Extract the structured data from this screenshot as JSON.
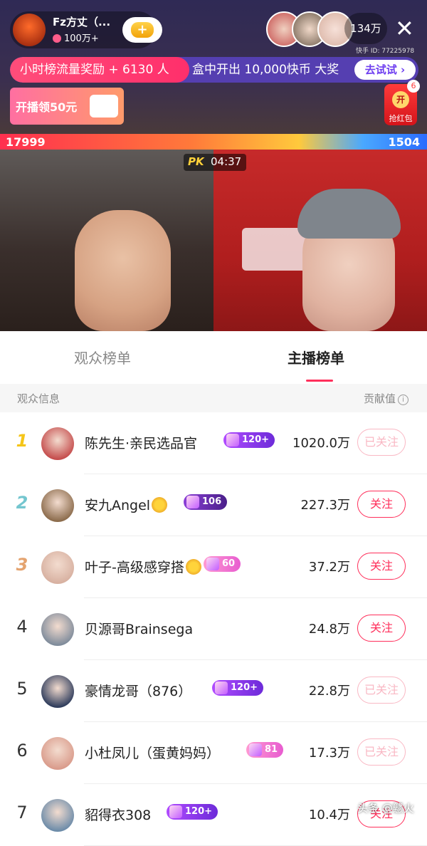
{
  "anchor": {
    "name": "Fz方丈（...",
    "likes": "100万+"
  },
  "viewer_count": "134万",
  "kuaishou_id": "快手 ID: 77225978",
  "promo": {
    "left": "小时榜流量奖励 + 6130 人",
    "middle": "盒中开出 10,000快币 大奖",
    "button": "去试试 ›"
  },
  "live_gift": {
    "text": "开播领50元"
  },
  "red_packet": {
    "count": "6",
    "open": "开",
    "label": "抢红包"
  },
  "pk": {
    "left_score": "17999",
    "right_score": "1504",
    "logo": "PK",
    "timer": "04:37"
  },
  "tabs": {
    "audience": "观众榜单",
    "anchor": "主播榜单"
  },
  "columns": {
    "left": "观众信息",
    "right": "贡献值",
    "info_icon": "i"
  },
  "rows": [
    {
      "rank": "1",
      "name": "陈先生·亲民选品官",
      "level": "120+",
      "score": "1020.0万",
      "action": "已关注",
      "followed": true,
      "avatar_color": "#c44a4a"
    },
    {
      "rank": "2",
      "name": "安九Angel",
      "level": "106",
      "score": "227.3万",
      "action": "关注",
      "followed": false,
      "avatar_color": "#8a6a4a"
    },
    {
      "rank": "3",
      "name": "叶子-高级感穿搭",
      "level": "60",
      "score": "37.2万",
      "action": "关注",
      "followed": false,
      "avatar_color": "#d7b0a0"
    },
    {
      "rank": "4",
      "name": "贝源哥Brainsega",
      "level": "",
      "score": "24.8万",
      "action": "关注",
      "followed": false,
      "avatar_color": "#7d8a9a"
    },
    {
      "rank": "5",
      "name": "豪情龙哥（876）",
      "level": "120+",
      "score": "22.8万",
      "action": "已关注",
      "followed": true,
      "avatar_color": "#2c3a5a"
    },
    {
      "rank": "6",
      "name": "小杜凤儿（蛋黄妈妈）",
      "level": "81",
      "score": "17.3万",
      "action": "已关注",
      "followed": true,
      "avatar_color": "#d99a8a"
    },
    {
      "rank": "7",
      "name": "貂得衣308",
      "level": "120+",
      "score": "10.4万",
      "action": "关注",
      "followed": false,
      "avatar_color": "#6a8aa8"
    }
  ],
  "watermark": "头条 @戆火",
  "colors": {
    "accent": "#ff2f5b",
    "followed": "#f9b8c4"
  }
}
